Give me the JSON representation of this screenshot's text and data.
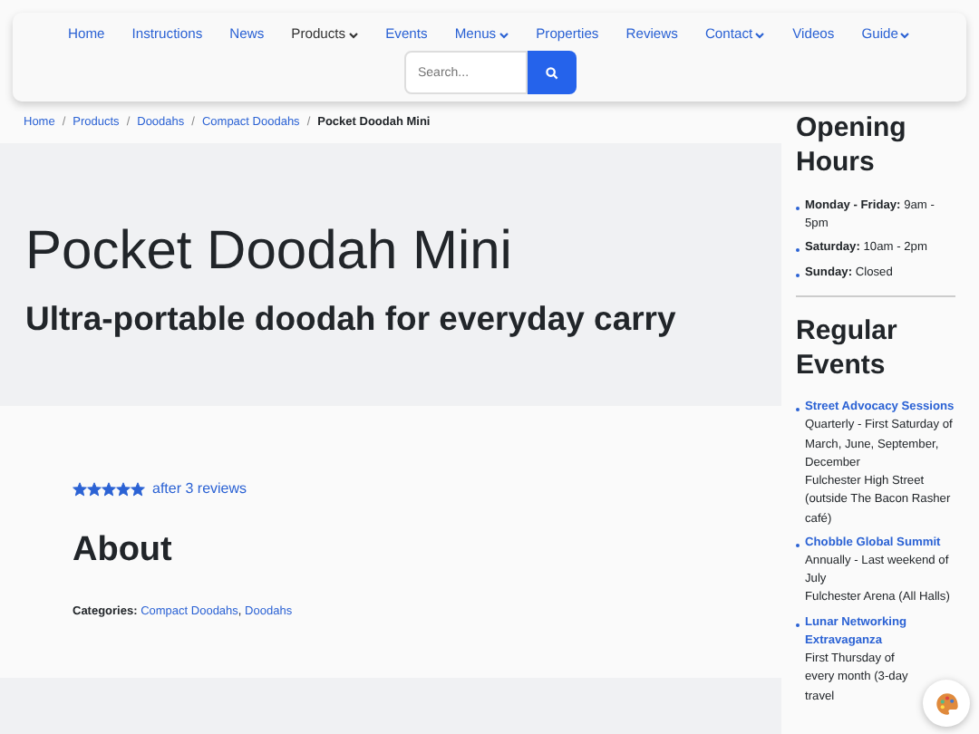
{
  "nav": {
    "items": [
      {
        "label": "Home",
        "dropdown": false,
        "selected": false
      },
      {
        "label": "Instructions",
        "dropdown": false,
        "selected": false
      },
      {
        "label": "News",
        "dropdown": false,
        "selected": false
      },
      {
        "label": "Products",
        "dropdown": true,
        "selected": true
      },
      {
        "label": "Events",
        "dropdown": false,
        "selected": false
      },
      {
        "label": "Menus",
        "dropdown": true,
        "selected": false
      },
      {
        "label": "Properties",
        "dropdown": false,
        "selected": false
      },
      {
        "label": "Reviews",
        "dropdown": false,
        "selected": false
      },
      {
        "label": "Contact",
        "dropdown": true,
        "selected": false
      },
      {
        "label": "Videos",
        "dropdown": false,
        "selected": false
      },
      {
        "label": "Guide",
        "dropdown": true,
        "selected": false
      }
    ],
    "search": {
      "placeholder": "Search..."
    }
  },
  "breadcrumb": {
    "separator": "/",
    "items": [
      "Home",
      "Products",
      "Doodahs",
      "Compact Doodahs",
      "Pocket Doodah Mini"
    ]
  },
  "hero": {
    "title": "Pocket Doodah Mini",
    "subtitle": "Ultra-portable doodah for everyday carry"
  },
  "rating": {
    "stars": 5,
    "text": "after 3 reviews"
  },
  "about": {
    "heading": "About",
    "categories_label": "Categories:",
    "categories": [
      "Compact Doodahs",
      "Doodahs"
    ],
    "categories_separator": ","
  },
  "sidebar": {
    "hours_heading": "Opening Hours",
    "hours": [
      {
        "day": "Monday - Friday:",
        "time": "9am - 5pm"
      },
      {
        "day": "Saturday:",
        "time": "10am - 2pm"
      },
      {
        "day": "Sunday:",
        "time": "Closed"
      }
    ],
    "events_heading": "Regular Events",
    "events": [
      {
        "name": "Street Advocacy Sessions",
        "details": [
          "Quarterly - First Saturday of March, June, September, December",
          "Fulchester High Street (outside The Bacon Rasher café)"
        ]
      },
      {
        "name": "Chobble Global Summit",
        "details": [
          "Annually - Last weekend of July",
          "Fulchester Arena (All Halls)"
        ]
      },
      {
        "name": "Lunar Networking Extravaganza",
        "details": [
          "First Thursday of every month (3-day travel"
        ]
      }
    ]
  }
}
